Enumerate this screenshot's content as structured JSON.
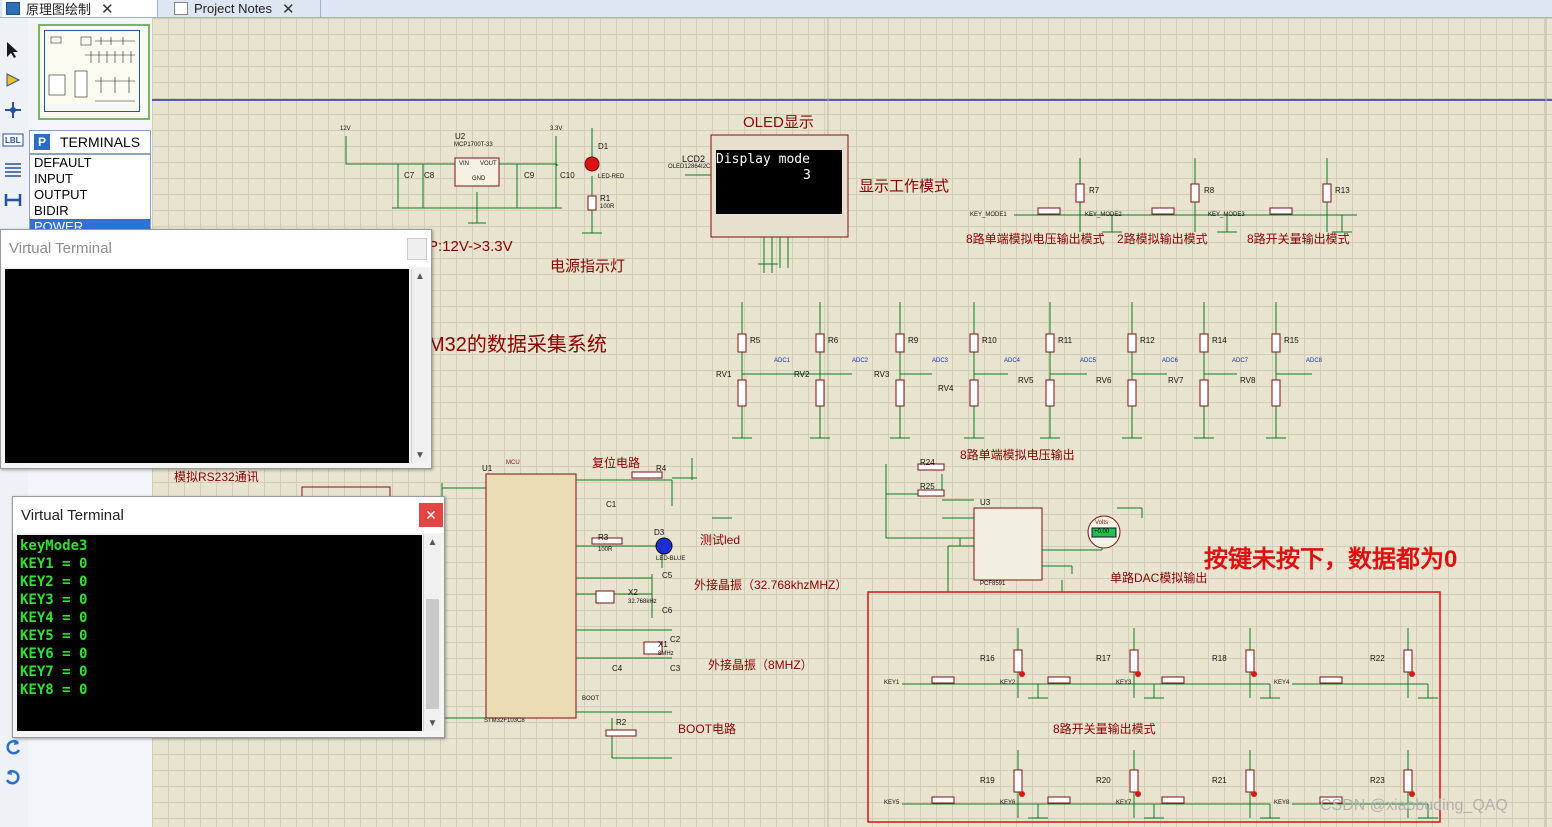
{
  "tabs": [
    {
      "label": "原理图绘制",
      "close": "✕"
    },
    {
      "label": "Project Notes",
      "close": "✕"
    }
  ],
  "toolbar_icons": [
    "select-arrow-icon",
    "component-icon",
    "junction-icon",
    "label-icon",
    "text-icon",
    "bus-icon",
    "undo-icon",
    "redo-icon"
  ],
  "selector": {
    "badge": "P",
    "title": "TERMINALS",
    "items": [
      "DEFAULT",
      "INPUT",
      "OUTPUT",
      "BIDIR",
      "POWER"
    ],
    "selected": "POWER"
  },
  "schematic": {
    "titles": {
      "oled": "OLED显示",
      "mode_display": "显示工作模式",
      "power_led": "电源指示灯",
      "regulator": "P:12V->3.3V",
      "system": "M32的数据采集系统",
      "rs232": "模拟RS232通讯",
      "reset": "复位电路",
      "test_led": "测试led",
      "crystal_32k": "外接晶振（32.768khzMHZ）",
      "crystal_8m": "外接晶振（8MHZ）",
      "boot": "BOOT电路",
      "dac": "单路DAC模拟输出",
      "analog8": "8路单端模拟电压输出",
      "mode1": "8路单端模拟电压输出模式",
      "mode2": "2路模拟输出模式",
      "mode3": "8路开关量输出模式",
      "switch8": "8路开关量输出模式",
      "note": "按键未按下，数据都为0",
      "watermark": "CSDN @xiaobuding_QAQ"
    },
    "lcd": {
      "ref": "LCD2",
      "part": "OLED12864I2C",
      "line1": "Display mode",
      "line2": "3"
    },
    "regulator": {
      "ref": "U2",
      "part": "MCP1700T-33",
      "pins": [
        "VIN",
        "VOUT",
        "GND"
      ]
    },
    "mcu": {
      "ref": "U1",
      "part": "STM32F103C8",
      "tag": "MCU"
    },
    "dac_chip": {
      "ref": "U3",
      "part": "PCF8591"
    },
    "voltmeter": {
      "label": "Volts",
      "value": "+0.00"
    },
    "rails": {
      "v33": "3.3V",
      "v12": "12V"
    },
    "passives": {
      "c7": "C7",
      "c8": "C8",
      "c9": "C9",
      "c10": "C10",
      "r1": "R1",
      "d1": "D1",
      "r1_val": "100R",
      "d1_part": "LED-RED",
      "r4": "R4",
      "r3": "R3",
      "r3_val": "100R",
      "d3": "D3",
      "d3_part": "LED-BLUE",
      "c1": "C1",
      "c5": "C5",
      "c6": "C6",
      "x2": "X2",
      "x2_val": "32.768kHz",
      "x1": "X1",
      "x1_val": "8MHz",
      "c2": "C2",
      "c3": "C3",
      "c4": "C4",
      "r2": "R2",
      "r24": "R24",
      "r25": "R25",
      "boot": "BOOT"
    },
    "mode_keys": [
      {
        "key": "KEY_MODE1",
        "r": "R7"
      },
      {
        "key": "KEY_MODE2",
        "r": "R8"
      },
      {
        "key": "KEY_MODE3",
        "r": "R13"
      }
    ],
    "pots": [
      {
        "r": "R5",
        "rv": "RV1",
        "adc": "ADC1"
      },
      {
        "r": "R6",
        "rv": "RV2",
        "adc": "ADC2"
      },
      {
        "r": "R9",
        "rv": "RV3",
        "adc": "ADC3"
      },
      {
        "r": "R10",
        "rv": "RV4",
        "adc": "ADC4"
      },
      {
        "r": "R11",
        "rv": "RV5",
        "adc": "ADC5"
      },
      {
        "r": "R12",
        "rv": "RV6",
        "adc": "ADC6"
      },
      {
        "r": "R14",
        "rv": "RV7",
        "adc": "ADC7"
      },
      {
        "r": "R15",
        "rv": "RV8",
        "adc": "ADC8"
      }
    ],
    "keys": [
      {
        "key": "KEY1",
        "r": "R16"
      },
      {
        "key": "KEY2",
        "r": "R17"
      },
      {
        "key": "KEY3",
        "r": "R18"
      },
      {
        "key": "KEY4",
        "r": "R22"
      },
      {
        "key": "KEY5",
        "r": "R19"
      },
      {
        "key": "KEY6",
        "r": "R20"
      },
      {
        "key": "KEY7",
        "r": "R21"
      },
      {
        "key": "KEY8",
        "r": "R23"
      }
    ]
  },
  "terminals": {
    "vt1_title": "Virtual Terminal",
    "vt2_title": "Virtual Terminal",
    "vt2_close": "✕",
    "vt2_lines": [
      "keyMode3",
      "KEY1 = 0",
      "KEY2 = 0",
      "KEY3 = 0",
      "KEY4 = 0",
      "KEY5 = 0",
      "KEY6 = 0",
      "KEY7 = 0",
      "KEY8 = 0"
    ]
  },
  "colors": {
    "canvas": "#e9e4d0",
    "grid": "#d3cdb6",
    "wire": "#0b7a1e",
    "label": "#8b0000",
    "highlight": "#e01010",
    "terminal_text": "#32e032"
  }
}
